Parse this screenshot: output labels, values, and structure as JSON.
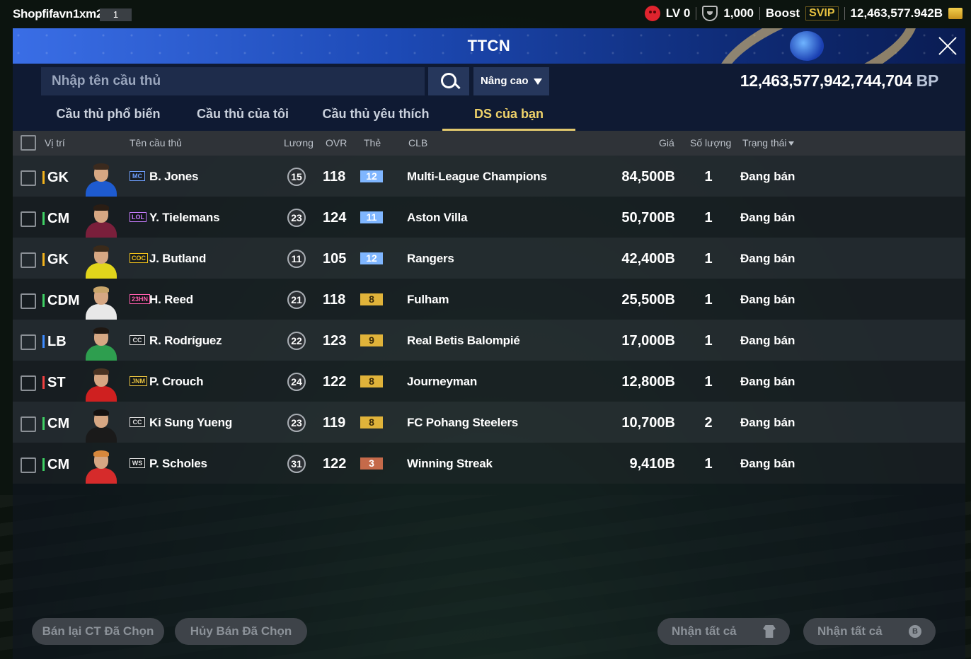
{
  "topbar": {
    "account_name": "Shopfifavn1xm2",
    "account_number": "1",
    "level": "LV 0",
    "medals": "1,000",
    "boost_label": "Boost",
    "svip_label": "SVIP",
    "bp": "12,463,577.942B"
  },
  "header": {
    "title": "TTCN"
  },
  "search": {
    "placeholder": "Nhập tên cầu thủ",
    "advanced_label": "Nâng cao",
    "bp_amount": "12,463,577,942,744,704",
    "bp_unit": "BP"
  },
  "tabs": [
    {
      "label": "Cầu thủ phổ biến"
    },
    {
      "label": "Cầu thủ của tôi"
    },
    {
      "label": "Cầu thủ yêu thích"
    },
    {
      "label": "DS của bạn"
    }
  ],
  "active_tab": 3,
  "table": {
    "headers": {
      "position": "Vị trí",
      "name": "Tên cầu thủ",
      "salary": "Lương",
      "ovr": "OVR",
      "card": "Thẻ",
      "club": "CLB",
      "price": "Giá",
      "quantity": "Số lượng",
      "status": "Trạng thái"
    },
    "rows": [
      {
        "position": "GK",
        "pos_color": "#f2b21b",
        "season": "MC",
        "season_color": "#6fa0ff",
        "name": "B. Jones",
        "salary": "15",
        "ovr": "118",
        "card_level": "12",
        "card_bg": "#7fb6ff",
        "card_fg": "#ffffff",
        "club": "Multi-League Champions",
        "price": "84,500B",
        "quantity": "1",
        "status": "Đang bán",
        "shirt": "#1e5bd0",
        "hair": "#3b2a1e"
      },
      {
        "position": "CM",
        "pos_color": "#3ecf63",
        "season": "LOL",
        "season_color": "#c77dff",
        "name": "Y. Tielemans",
        "salary": "23",
        "ovr": "124",
        "card_level": "11",
        "card_bg": "#7fb6ff",
        "card_fg": "#ffffff",
        "club": "Aston Villa",
        "price": "50,700B",
        "quantity": "1",
        "status": "Đang bán",
        "shirt": "#7a1f3b",
        "hair": "#2a1d14"
      },
      {
        "position": "GK",
        "pos_color": "#f2b21b",
        "season": "COC",
        "season_color": "#f2c21b",
        "name": "J. Butland",
        "salary": "11",
        "ovr": "105",
        "card_level": "12",
        "card_bg": "#7fb6ff",
        "card_fg": "#ffffff",
        "club": "Rangers",
        "price": "42,400B",
        "quantity": "1",
        "status": "Đang bán",
        "shirt": "#e2d51b",
        "hair": "#3a2a1a"
      },
      {
        "position": "CDM",
        "pos_color": "#3ecf63",
        "season": "23HN",
        "season_color": "#ff5fae",
        "name": "H. Reed",
        "salary": "21",
        "ovr": "118",
        "card_level": "8",
        "card_bg": "#e0b33a",
        "card_fg": "#3a2a08",
        "club": "Fulham",
        "price": "25,500B",
        "quantity": "1",
        "status": "Đang bán",
        "shirt": "#e8e8e8",
        "hair": "#c9a56a"
      },
      {
        "position": "LB",
        "pos_color": "#3d8bff",
        "season": "CC",
        "season_color": "#e0e0e0",
        "name": "R. Rodríguez",
        "salary": "22",
        "ovr": "123",
        "card_level": "9",
        "card_bg": "#e0b33a",
        "card_fg": "#3a2a08",
        "club": "Real Betis Balompié",
        "price": "17,000B",
        "quantity": "1",
        "status": "Đang bán",
        "shirt": "#2e9e4f",
        "hair": "#1e1712"
      },
      {
        "position": "ST",
        "pos_color": "#f04040",
        "season": "JNM",
        "season_color": "#e6c140",
        "name": "P. Crouch",
        "salary": "24",
        "ovr": "122",
        "card_level": "8",
        "card_bg": "#e0b33a",
        "card_fg": "#3a2a08",
        "club": "Journeyman",
        "price": "12,800B",
        "quantity": "1",
        "status": "Đang bán",
        "shirt": "#cf2020",
        "hair": "#4a3322"
      },
      {
        "position": "CM",
        "pos_color": "#3ecf63",
        "season": "CC",
        "season_color": "#e0e0e0",
        "name": "Ki Sung Yueng",
        "salary": "23",
        "ovr": "119",
        "card_level": "8",
        "card_bg": "#e0b33a",
        "card_fg": "#3a2a08",
        "club": "FC Pohang Steelers",
        "price": "10,700B",
        "quantity": "2",
        "status": "Đang bán",
        "shirt": "#1a1a1a",
        "hair": "#151110"
      },
      {
        "position": "CM",
        "pos_color": "#3ecf63",
        "season": "WS",
        "season_color": "#e0e0e0",
        "name": "P. Scholes",
        "salary": "31",
        "ovr": "122",
        "card_level": "3",
        "card_bg": "#c56a4a",
        "card_fg": "#ffffff",
        "club": "Winning Streak",
        "price": "9,410B",
        "quantity": "1",
        "status": "Đang bán",
        "shirt": "#d62b2b",
        "hair": "#d7883c"
      }
    ]
  },
  "footer": {
    "resell_label": "Bán lại CT Đã Chọn",
    "cancel_label": "Hủy Bán Đã Chọn",
    "claim_all_players_label": "Nhận tất cả",
    "claim_all_bp_label": "Nhận tất cả"
  }
}
